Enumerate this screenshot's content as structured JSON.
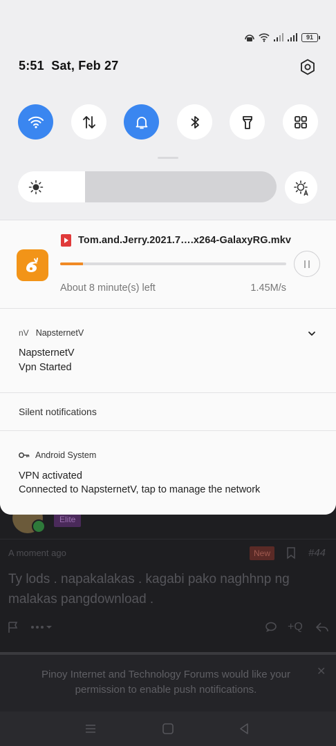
{
  "status_bar": {
    "battery": "91",
    "colors": {
      "tile_active": "#3a86f0",
      "progress": "#f08a24",
      "app_icon_bg": "#f29418"
    }
  },
  "header": {
    "time": "5:51",
    "date": "Sat, Feb 27"
  },
  "quick_tiles": [
    {
      "name": "wifi",
      "icon": "wifi-icon",
      "active": true
    },
    {
      "name": "mobile-data",
      "icon": "data-arrows-icon",
      "active": false
    },
    {
      "name": "sound",
      "icon": "bell-icon",
      "active": true
    },
    {
      "name": "bluetooth",
      "icon": "bluetooth-icon",
      "active": false
    },
    {
      "name": "flashlight",
      "icon": "flashlight-icon",
      "active": false
    },
    {
      "name": "more",
      "icon": "grid-icon",
      "active": false
    }
  ],
  "brightness": {
    "level": 0.26,
    "icon": "sun-icon",
    "auto_icon": "auto-brightness-icon"
  },
  "download": {
    "app_icon": "uc-browser-icon",
    "file_icon": "video-file-icon",
    "filename": "Tom.and.Jerry.2021.7….x264-GalaxyRG.mkv",
    "progress": 0.1,
    "remaining": "About 8 minute(s) left",
    "speed": "1.45M/s"
  },
  "vpn_notification": {
    "app_abbr": "nV",
    "app_name": "NapsternetV",
    "title": "NapsternetV",
    "body": "Vpn Started"
  },
  "silent_section": {
    "label": "Silent notifications"
  },
  "system_notification": {
    "app_name": "Android System",
    "title": "VPN activated",
    "body": "Connected to NapsternetV, tap to manage the network"
  },
  "background_page": {
    "badge": "Elite",
    "time": "A moment ago",
    "new_label": "New",
    "post_number": "#44",
    "post_text": "Ty lods . napakalakas . kagabi pako naghhnp ng malakas pangdownload .",
    "quote_label": "+Q",
    "push_prompt": "Pinoy Internet and Technology Forums would like your permission to enable push notifications."
  }
}
